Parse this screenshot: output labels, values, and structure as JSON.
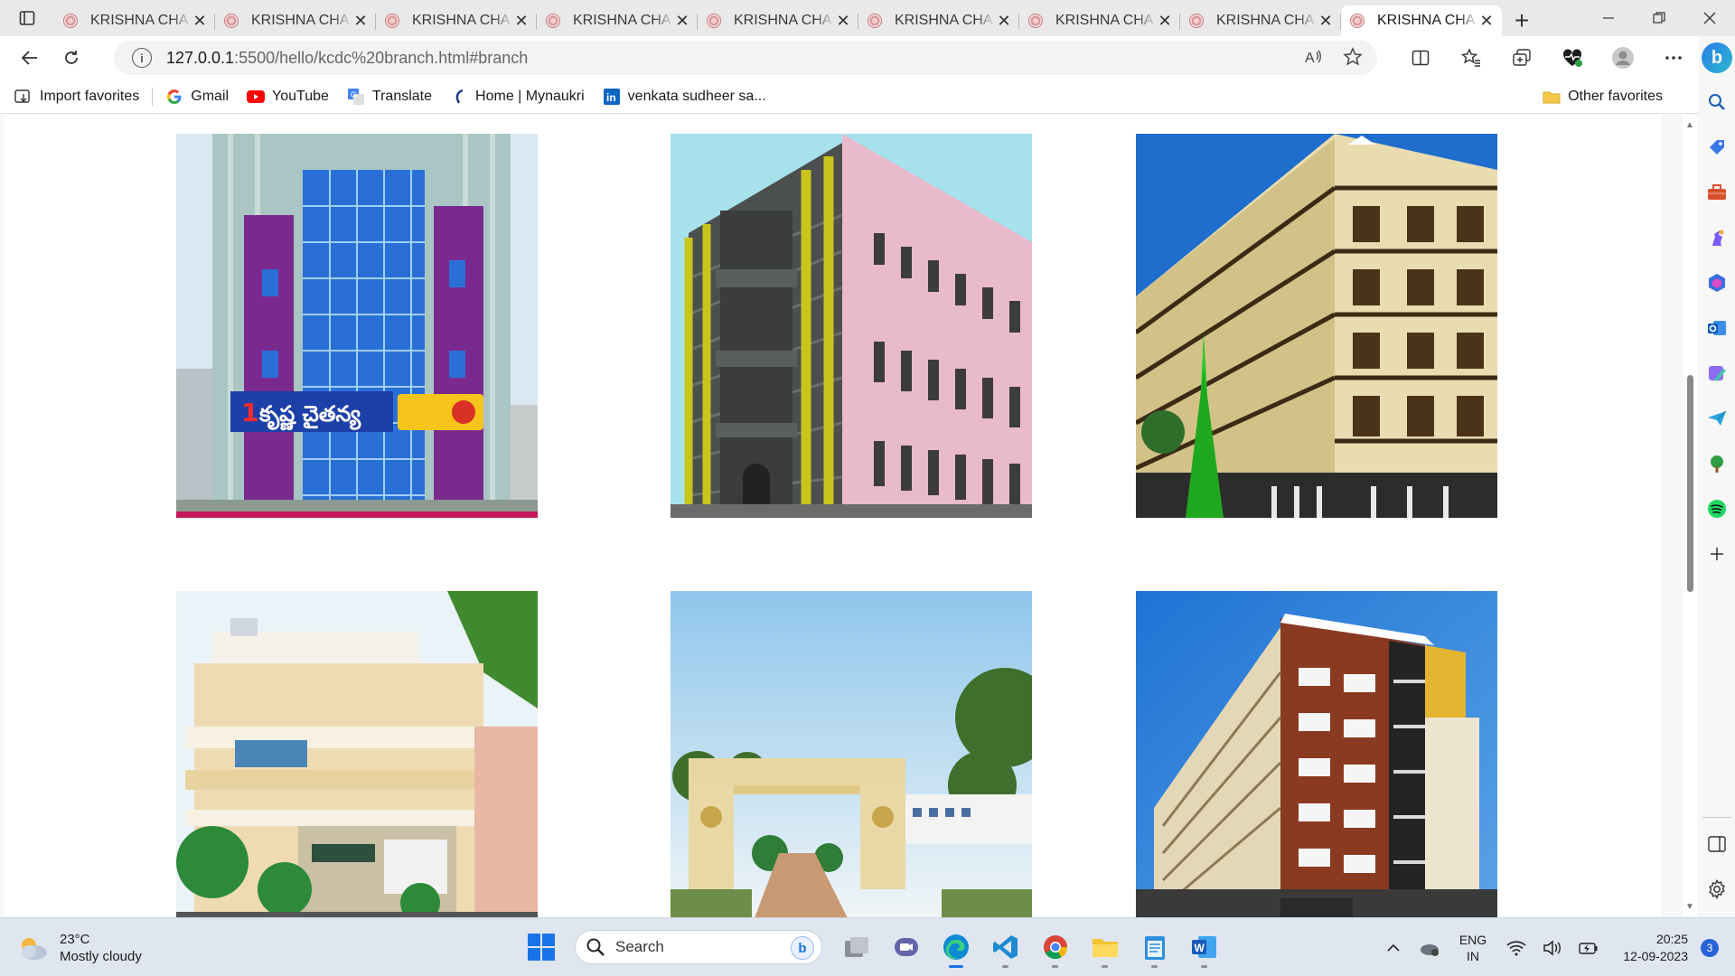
{
  "browser": {
    "tabs": [
      {
        "title": "KRISHNA CHA",
        "active": false
      },
      {
        "title": "KRISHNA CHA",
        "active": false
      },
      {
        "title": "KRISHNA CHA",
        "active": false
      },
      {
        "title": "KRISHNA CHA",
        "active": false
      },
      {
        "title": "KRISHNA CHA",
        "active": false
      },
      {
        "title": "KRISHNA CHA",
        "active": false
      },
      {
        "title": "KRISHNA CHA",
        "active": false
      },
      {
        "title": "KRISHNA CHA",
        "active": false
      },
      {
        "title": "KRISHNA CHA",
        "active": true
      }
    ],
    "close_glyph": "✕",
    "address": {
      "host": "127.0.0.1",
      "path": ":5500/hello/kcdc%20branch.html#branch"
    },
    "favorites": [
      {
        "label": "Import favorites",
        "icon": "import-icon"
      },
      {
        "label": "Gmail",
        "icon": "google-icon"
      },
      {
        "label": "YouTube",
        "icon": "youtube-icon"
      },
      {
        "label": "Translate",
        "icon": "translate-icon"
      },
      {
        "label": "Home | Mynaukri",
        "icon": "mynaukri-icon"
      },
      {
        "label": "venkata sudheer sa...",
        "icon": "linkedin-icon"
      }
    ],
    "other_favorites": "Other favorites"
  },
  "content": {
    "branch_images": [
      {
        "depicts": "glass-facade-building",
        "sign_text": "కృష్ణ చైతన్య"
      },
      {
        "depicts": "grey-yellow-building"
      },
      {
        "depicts": "cream-illustrated-building"
      },
      {
        "depicts": "residential-house-building"
      },
      {
        "depicts": "campus-entrance-gate"
      },
      {
        "depicts": "red-brown-apartment-building"
      }
    ]
  },
  "taskbar": {
    "weather": {
      "temp": "23°C",
      "condition": "Mostly cloudy"
    },
    "search_placeholder": "Search",
    "lang_line1": "ENG",
    "lang_line2": "IN",
    "time": "20:25",
    "date": "12-09-2023",
    "notification_count": "3"
  },
  "colors": {
    "accent": "#1a73e8",
    "taskbar": "#dfe6ef"
  }
}
